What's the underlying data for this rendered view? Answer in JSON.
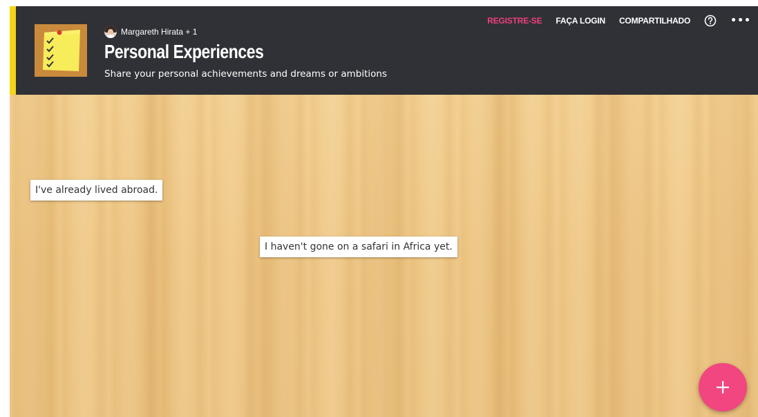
{
  "header": {
    "contributors": "Margareth Hirata + 1",
    "title": "Personal Experiences",
    "subtitle": "Share your personal achievements and dreams or ambitions"
  },
  "nav": {
    "register": "REGISTRE-SE",
    "login": "FAÇA LOGIN",
    "shared": "COMPARTILHADO"
  },
  "posts": [
    {
      "text": "I've already lived abroad."
    },
    {
      "text": "I haven't gone on a safari in Africa yet."
    }
  ],
  "icons": {
    "logo": "sticky-note-checklist-icon",
    "help": "question-circle-icon",
    "more": "more-horizontal-icon",
    "add": "plus-icon"
  },
  "colors": {
    "header_bg": "#2f3136",
    "accent_bar": "#f2d61a",
    "register": "#ef3f7d",
    "fab": "#f1467f",
    "board_wood": "#f0ca8a"
  }
}
